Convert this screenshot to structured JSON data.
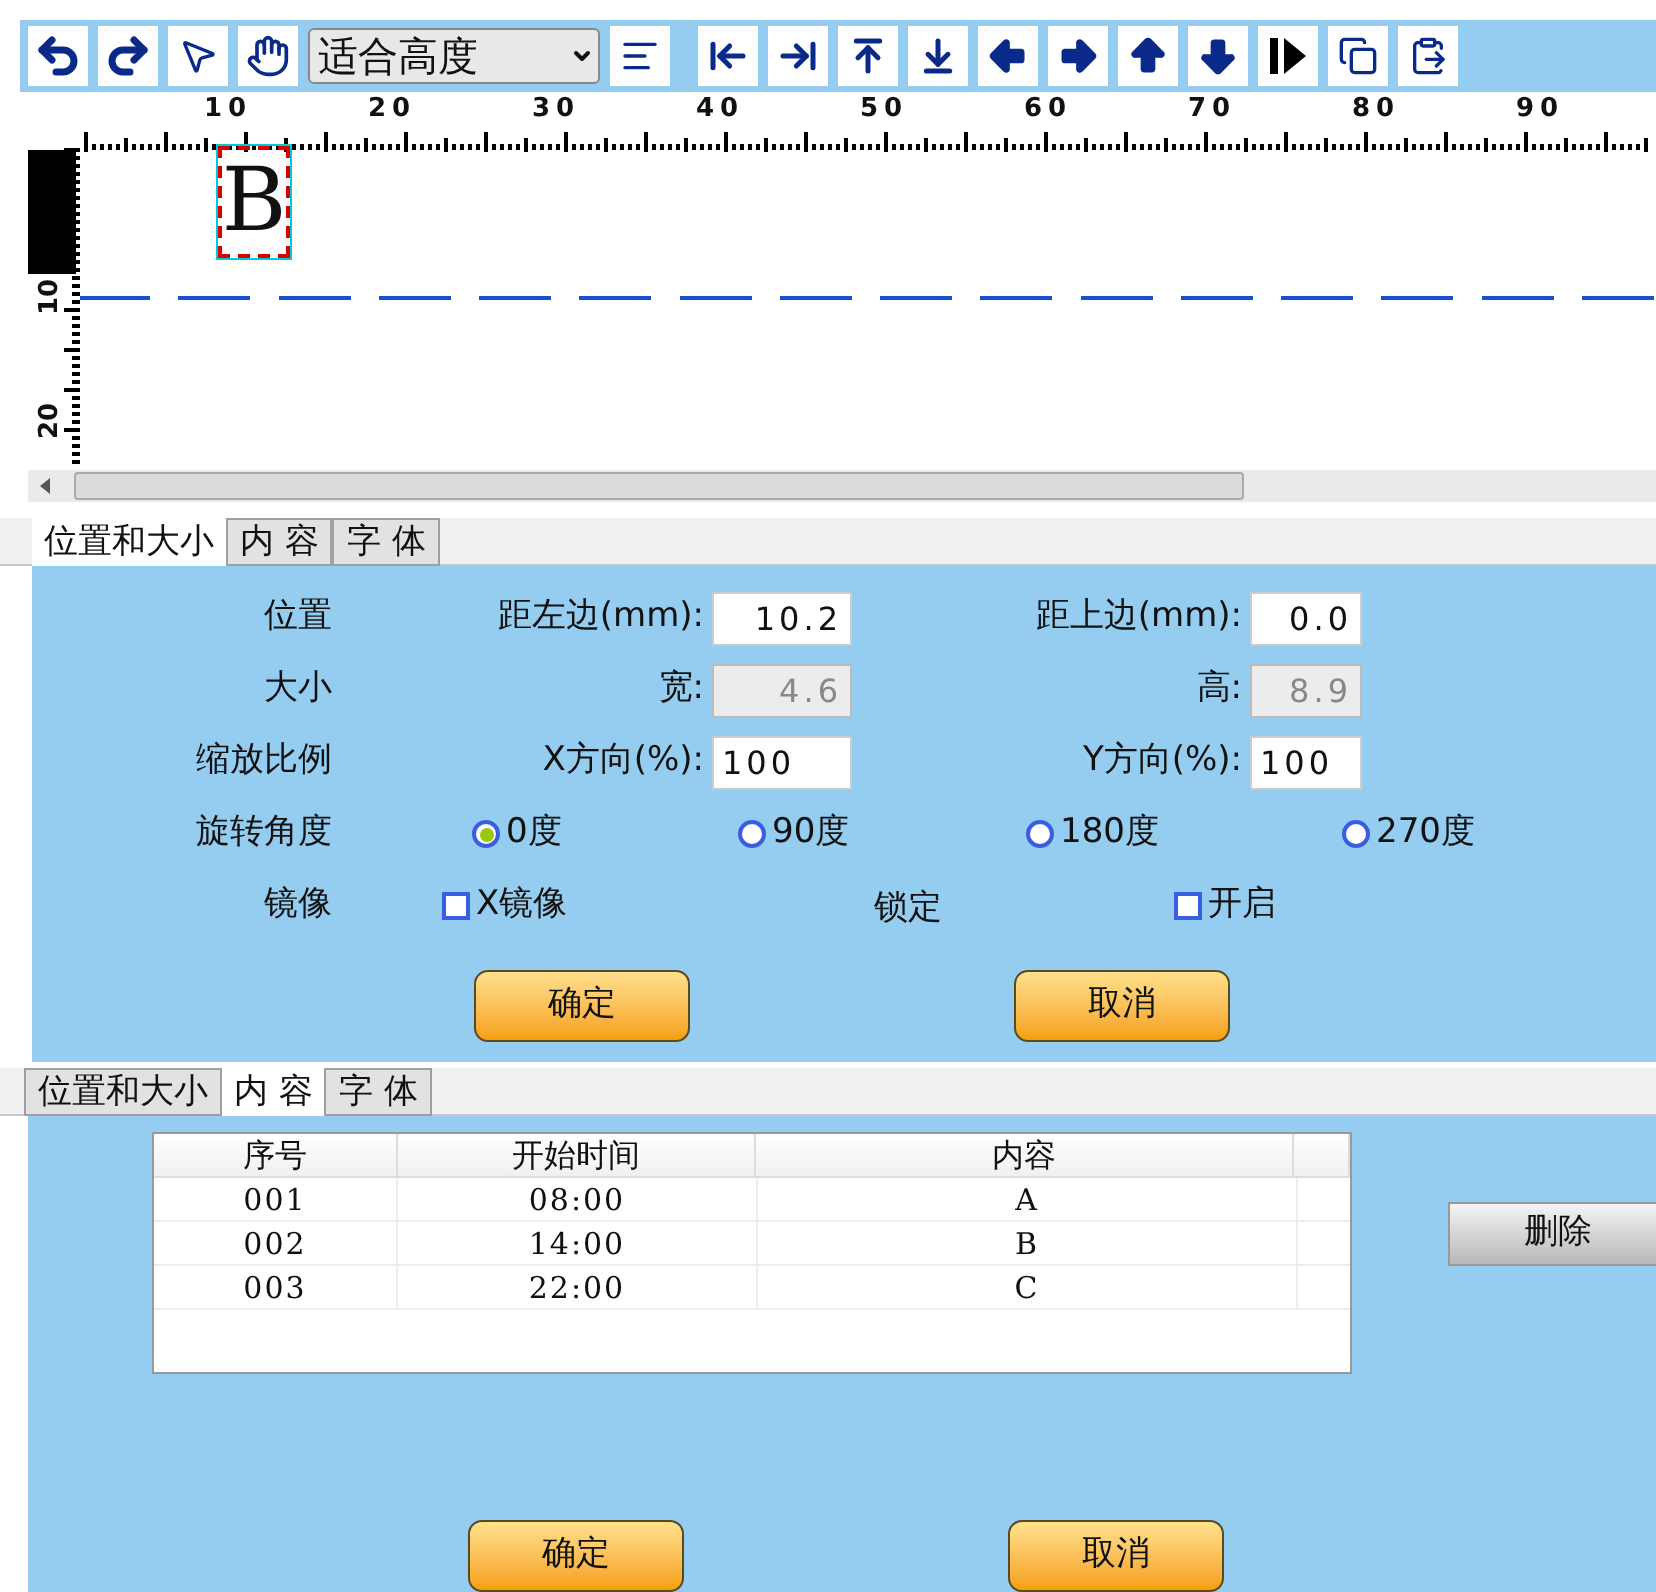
{
  "toolbar": {
    "zoom_select": "适合高度"
  },
  "ruler": {
    "x_labels": [
      "10",
      "20",
      "30",
      "40",
      "50",
      "60",
      "70",
      "80",
      "90"
    ],
    "y_labels": [
      "10",
      "20"
    ]
  },
  "canvas": {
    "element_text": "B",
    "selected": true
  },
  "position_panel": {
    "tabs": [
      {
        "label": "位置和大小",
        "selected": true
      },
      {
        "label": "内 容",
        "selected": false
      },
      {
        "label": "字 体",
        "selected": false
      }
    ],
    "rows": [
      {
        "kind": "fields",
        "label": "位置",
        "fields": [
          {
            "label": "距左边(mm):",
            "value": "10.2",
            "disabled": false
          },
          {
            "label": "距上边(mm):",
            "value": "0.0",
            "disabled": false
          }
        ]
      },
      {
        "kind": "fields",
        "label": "大小",
        "fields": [
          {
            "label": "宽:",
            "value": "4.6",
            "disabled": true
          },
          {
            "label": "高:",
            "value": "8.9",
            "disabled": true
          }
        ]
      },
      {
        "kind": "fields",
        "label": "缩放比例",
        "fields": [
          {
            "label": "X方向(%):",
            "value": "100",
            "disabled": false
          },
          {
            "label": "Y方向(%):",
            "value": "100",
            "disabled": false
          }
        ]
      },
      {
        "kind": "radio",
        "label": "旋转角度",
        "options": [
          {
            "label": "0度",
            "selected": true
          },
          {
            "label": "90度",
            "selected": false
          },
          {
            "label": "180度",
            "selected": false
          },
          {
            "label": "270度",
            "selected": false
          }
        ]
      },
      {
        "kind": "mirror",
        "label": "镜像",
        "items": [
          {
            "kind": "checkbox",
            "label": "X镜像",
            "checked": false
          },
          {
            "kind": "text",
            "label": "锁定"
          },
          {
            "kind": "checkbox",
            "label": "开启",
            "checked": false
          }
        ]
      }
    ],
    "buttons": [
      "确定",
      "取消"
    ]
  },
  "content_panel": {
    "tabs": [
      {
        "label": "位置和大小",
        "selected": false
      },
      {
        "label": "内 容",
        "selected": true
      },
      {
        "label": "字 体",
        "selected": false
      }
    ],
    "table": {
      "columns": [
        "序号",
        "开始时间",
        "内容"
      ],
      "rows": [
        [
          "001",
          "08:00",
          "A"
        ],
        [
          "002",
          "14:00",
          "B"
        ],
        [
          "003",
          "22:00",
          "C"
        ]
      ]
    },
    "delete_button": "删除",
    "buttons": [
      "确定",
      "取消"
    ]
  }
}
